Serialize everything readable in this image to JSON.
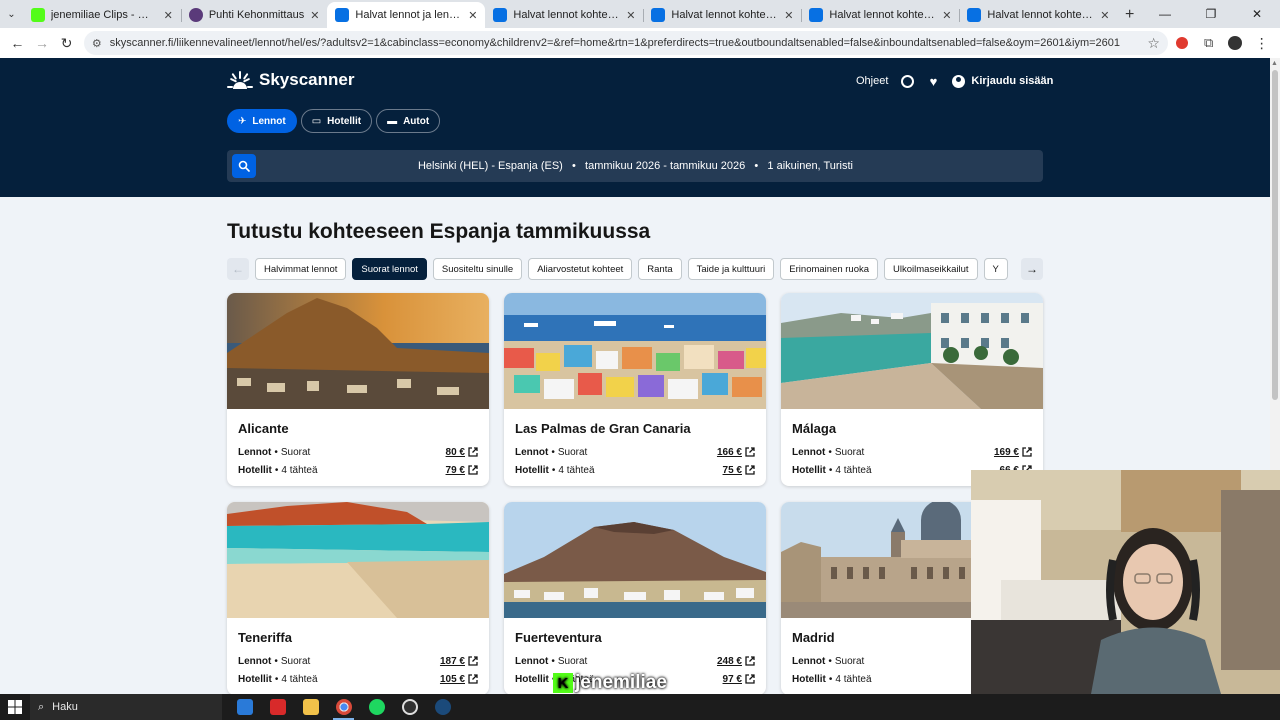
{
  "browser": {
    "tabs": [
      {
        "title": "jenemiliae Clips - Watch Live on",
        "color": "#53fc18"
      },
      {
        "title": "Puhti Kehonmittaus",
        "color": "#5a3a7a"
      },
      {
        "title": "Halvat lennot ja lentoliput kaik",
        "color": "#0770e3",
        "active": true
      },
      {
        "title": "Halvat lennot kohteesta Helsin",
        "color": "#0770e3"
      },
      {
        "title": "Halvat lennot kohteesta Turku",
        "color": "#0770e3"
      },
      {
        "title": "Halvat lennot kohteesta Turku",
        "color": "#0770e3"
      },
      {
        "title": "Halvat lennot kohteesta Helsin",
        "color": "#0770e3"
      }
    ],
    "url": "skyscanner.fi/liikennevalineet/lennot/hel/es/?adultsv2=1&cabinclass=economy&childrenv2=&ref=home&rtn=1&preferdirects=true&outboundaltsenabled=false&inboundaltsenabled=false&oym=2601&iym=2601"
  },
  "header": {
    "logo": "Skyscanner",
    "help": "Ohjeet",
    "login": "Kirjaudu sisään",
    "nav": [
      {
        "label": "Lennot",
        "icon": "plane-icon",
        "active": true
      },
      {
        "label": "Hotellit",
        "icon": "bed-icon"
      },
      {
        "label": "Autot",
        "icon": "car-icon"
      }
    ],
    "search_summary": "Helsinki (HEL) - Espanja (ES)   •   tammikuu 2026 - tammikuu 2026   •   1 aikuinen, Turisti"
  },
  "main": {
    "title": "Tutustu kohteeseen Espanja tammikuussa",
    "chips": [
      {
        "label": "Halvimmat lennot"
      },
      {
        "label": "Suorat lennot",
        "active": true
      },
      {
        "label": "Suositeltu sinulle"
      },
      {
        "label": "Aliarvostetut kohteet"
      },
      {
        "label": "Ranta"
      },
      {
        "label": "Taide ja kulttuuri"
      },
      {
        "label": "Erinomainen ruoka"
      },
      {
        "label": "Ulkoilmaseikkailut"
      },
      {
        "label": "Y"
      }
    ],
    "labels": {
      "flights": "Lennot",
      "direct": "Suorat",
      "hotels": "Hotellit",
      "stars": "4 tähteä"
    },
    "cards": [
      {
        "city": "Alicante",
        "flight_price": "80 €",
        "hotel_price": "79 €"
      },
      {
        "city": "Las Palmas de Gran Canaria",
        "flight_price": "166 €",
        "hotel_price": "75 €"
      },
      {
        "city": "Málaga",
        "flight_price": "169 €",
        "hotel_price": "66 €"
      },
      {
        "city": "Teneriffa",
        "flight_price": "187 €",
        "hotel_price": "105 €"
      },
      {
        "city": "Fuerteventura",
        "flight_price": "248 €",
        "hotel_price": "97 €"
      },
      {
        "city": "Madrid",
        "flight_price": "",
        "hotel_price": ""
      }
    ]
  },
  "overlay": {
    "watermark": "jenemiliae",
    "watermark_letter": "K"
  },
  "taskbar": {
    "search": "Haku"
  },
  "colors": {
    "brand_dark": "#05203c",
    "brand_blue": "#0062e3",
    "page_bg": "#eff3f8"
  }
}
